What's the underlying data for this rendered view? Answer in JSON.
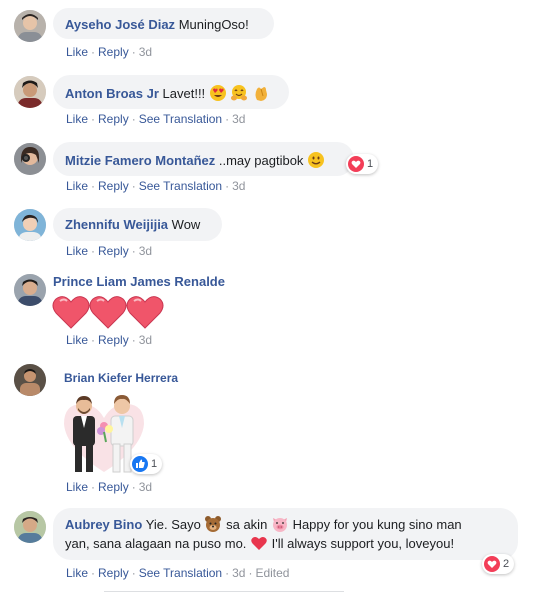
{
  "comments": [
    {
      "author": "Ayseho José Diaz",
      "text": "MuningOso!",
      "like": "Like",
      "reply": "Reply",
      "time": "3d"
    },
    {
      "author": "Anton Broas Jr",
      "text": "Lavet!!!",
      "like": "Like",
      "reply": "Reply",
      "translation": "See Translation",
      "time": "3d"
    },
    {
      "author": "Mitzie Famero Montañez",
      "text": "..may pagtibok",
      "like": "Like",
      "reply": "Reply",
      "translation": "See Translation",
      "time": "3d",
      "reaction_count": "1"
    },
    {
      "author": "Zhennifu Weijijia",
      "text": "Wow",
      "like": "Like",
      "reply": "Reply",
      "time": "3d"
    },
    {
      "author": "Prince Liam James Renalde",
      "like": "Like",
      "reply": "Reply",
      "time": "3d"
    },
    {
      "author": "Brian Kiefer Herrera",
      "like": "Like",
      "reply": "Reply",
      "time": "3d",
      "reaction_count": "1"
    },
    {
      "author": "Aubrey Bino",
      "text_1": "Yie. Sayo",
      "text_2": "sa akin",
      "text_3": "Happy for you kung sino man",
      "text_4": "yan, sana alagaan na puso mo.",
      "text_5": "I'll always support you, loveyou!",
      "like": "Like",
      "reply": "Reply",
      "translation": "See Translation",
      "time": "3d",
      "edited": "Edited",
      "reaction_count": "2"
    }
  ],
  "colors": {
    "name": "#385898",
    "bubble": "#f2f3f5",
    "meta": "#90949c",
    "love": "#f33e58",
    "like": "#1877f2"
  },
  "icons": {
    "love_reaction": "heart-icon",
    "like_reaction": "thumbs-up-icon"
  }
}
